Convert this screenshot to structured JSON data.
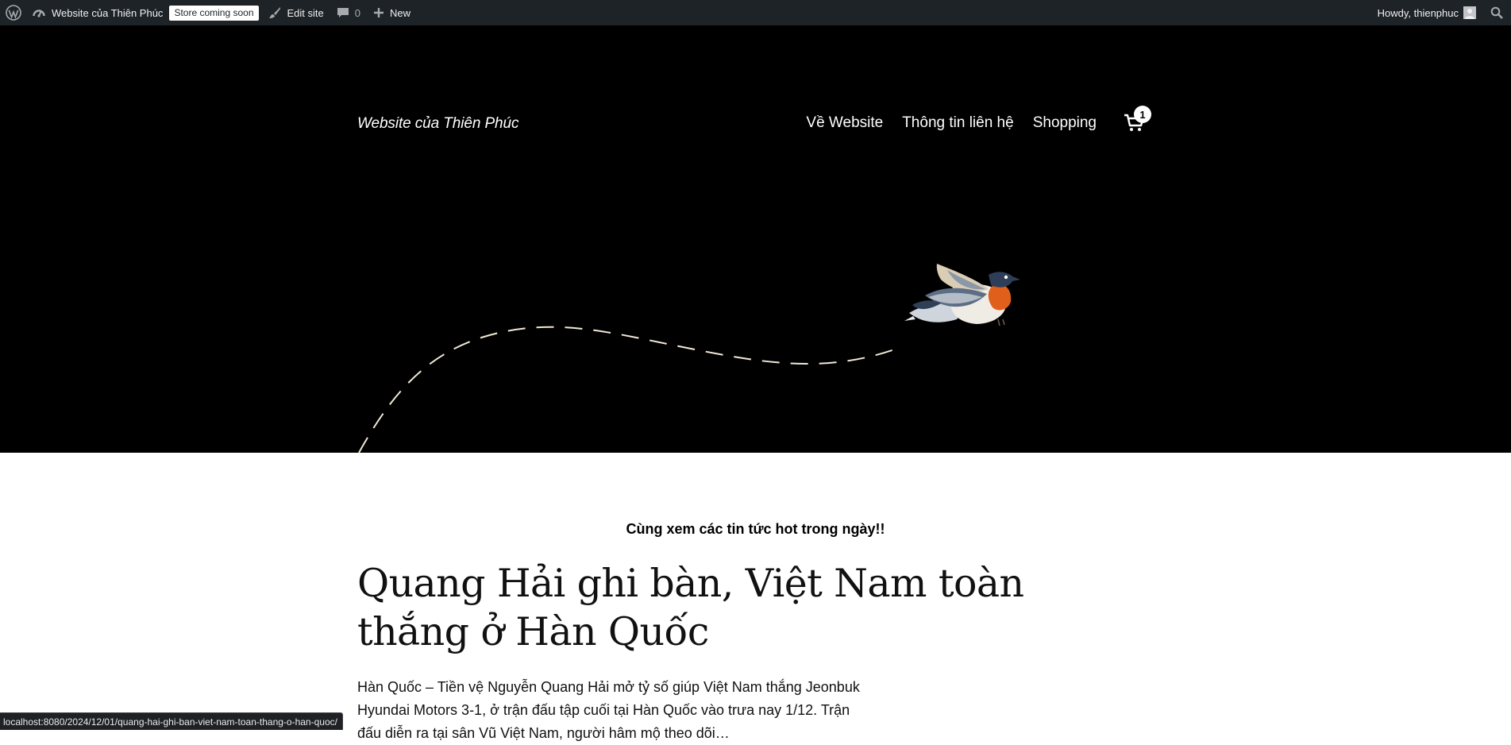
{
  "adminbar": {
    "site_name": "Website của Thiên Phúc",
    "store_badge": "Store coming soon",
    "edit_site": "Edit site",
    "comments_count": "0",
    "new_label": "New",
    "howdy": "Howdy, thienphuc",
    "icons": [
      "wordpress-icon",
      "dashboard-icon",
      "brush-icon",
      "comment-icon",
      "plus-icon",
      "avatar",
      "search-icon"
    ]
  },
  "header": {
    "site_title": "Website của Thiên Phúc",
    "nav": [
      "Về Website",
      "Thông tin liên hệ",
      "Shopping"
    ],
    "cart_count": "1"
  },
  "main": {
    "tagline": "Cùng xem các tin tức hot trong ngày!!",
    "post_title": "Quang Hải ghi bàn, Việt Nam toàn thắng ở Hàn Quốc",
    "excerpt": "Hàn Quốc – Tiền vệ Nguyễn Quang Hải mở tỷ số giúp Việt Nam thắng Jeonbuk Hyundai Motors 3-1, ở trận đấu tập cuối tại Hàn Quốc vào trưa nay 1/12. Trận đấu diễn ra tại sân Vũ Việt Nam, người hâm mộ theo dõi…"
  },
  "statusbar": {
    "url": "localhost:8080/2024/12/01/quang-hai-ghi-ban-viet-nam-toan-thang-o-han-quoc/"
  },
  "colors": {
    "adminbar_bg": "#1d2327",
    "hero_bg": "#000000",
    "text": "#111111"
  }
}
